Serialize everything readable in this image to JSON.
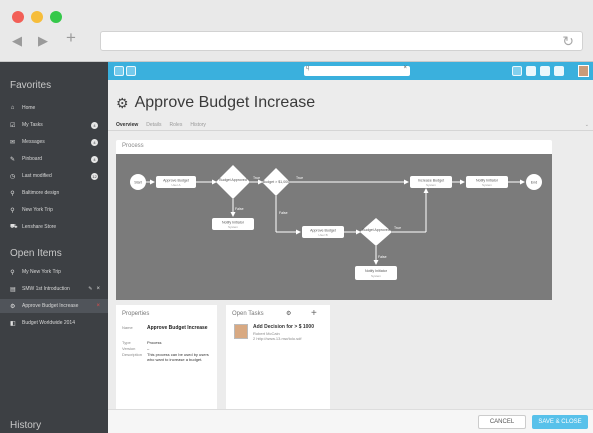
{
  "sidebar": {
    "favorites_title": "Favorites",
    "favorites": [
      {
        "label": "Home",
        "icon": "home-icon",
        "badge": ""
      },
      {
        "label": "My Tasks",
        "icon": "tasks-icon",
        "badge": "4"
      },
      {
        "label": "Messages",
        "icon": "messages-icon",
        "badge": "4"
      },
      {
        "label": "Pinboard",
        "icon": "pin-icon",
        "badge": "4"
      },
      {
        "label": "Last modified",
        "icon": "clock-icon",
        "badge": "12"
      },
      {
        "label": "Baltimore design",
        "icon": "search-icon",
        "badge": ""
      },
      {
        "label": "New York Trip",
        "icon": "search-icon",
        "badge": ""
      },
      {
        "label": "Lenshare Store",
        "icon": "cart-icon",
        "badge": ""
      }
    ],
    "open_items_title": "Open Items",
    "open_items": [
      {
        "label": "My New York Trip",
        "icon": "search-icon"
      },
      {
        "label": "SMW 1st Introduction",
        "icon": "doc-icon"
      },
      {
        "label": "Approve Budget Increase",
        "icon": "gear-icon"
      },
      {
        "label": "Budget Worldwide 2014",
        "icon": "chart-icon"
      }
    ],
    "history_title": "History"
  },
  "toolbar": {
    "search_icon": "q",
    "clear_icon": "×"
  },
  "main": {
    "title": "Approve Budget Increase",
    "tabs": [
      "Overview",
      "Details",
      "Roles",
      "History"
    ],
    "process_title": "Process"
  },
  "process": {
    "nodes": {
      "start": "Start",
      "approve1": "Approve Budget",
      "approve1_sub": "User A",
      "budget_approved1": "Budget Approved",
      "budget_gt": "Budget > $1,000",
      "increase": "Increase Budget",
      "increase_sub": "System",
      "notify1": "Notify Initiator",
      "notify1_sub": "System",
      "end": "End",
      "notify2": "Notify Initiator",
      "notify2_sub": "System",
      "approve2": "Approve Budget",
      "approve2_sub": "User B",
      "budget_approved2": "Budget Approved",
      "notify3": "Notify Initiator",
      "notify3_sub": "System"
    },
    "edge_labels": {
      "true": "True",
      "false": "False"
    }
  },
  "properties": {
    "title": "Properties",
    "rows": [
      {
        "k": "Name",
        "v": "Approve Budget Increase"
      },
      {
        "k": "Type",
        "v": "Process"
      },
      {
        "k": "Version",
        "v": "–"
      },
      {
        "k": "Description",
        "v": "This process can be used by users who want to increase a budget."
      }
    ]
  },
  "open_tasks": {
    "title": "Open Tasks",
    "task_title": "Add Decision for > $ 1000",
    "task_line2": "Robert McCain",
    "task_line3": "2 http://www.13.mw/iolo.sdf"
  },
  "footer": {
    "cancel": "CANCEL",
    "save": "SAVE & CLOSE"
  }
}
